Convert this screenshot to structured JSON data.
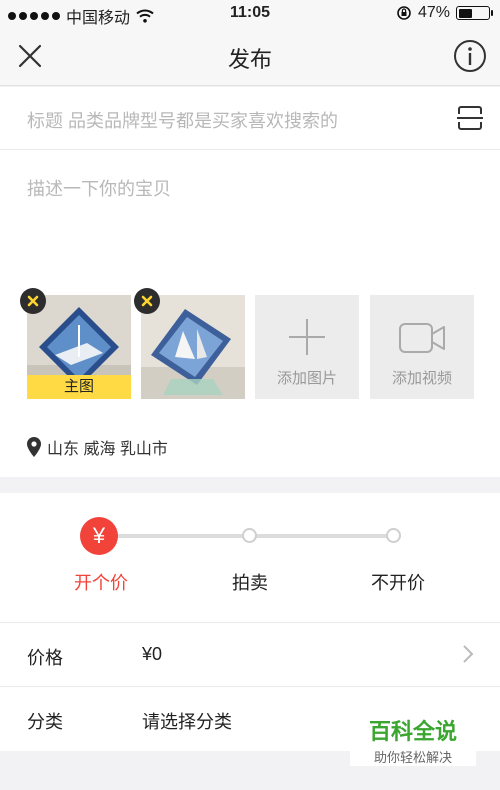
{
  "status_bar": {
    "carrier": "中国移动",
    "time": "11:05",
    "battery": "47%",
    "battery_level": 0.47,
    "icons": [
      "signal-dots-icon",
      "wifi-icon",
      "orientation-lock-icon",
      "battery-icon"
    ]
  },
  "nav": {
    "title": "发布",
    "icons": [
      "close-icon",
      "info-icon"
    ]
  },
  "form": {
    "title_placeholder": "标题 品类品牌型号都是买家喜欢搜索的",
    "description_placeholder": "描述一下你的宝贝",
    "main_image_tag": "主图",
    "add_image_label": "添加图片",
    "add_video_label": "添加视频",
    "location": "山东 威海 乳山市",
    "icons": [
      "scan-icon",
      "remove-icon",
      "plus-icon",
      "video-camera-icon",
      "location-pin-icon"
    ]
  },
  "pricing": {
    "slider_symbol": "¥",
    "options": [
      "开个价",
      "拍卖",
      "不开价"
    ],
    "selected_option": "开个价",
    "accent_color": "#f2433b",
    "price_label": "价格",
    "price_value": "¥0",
    "category_label": "分类",
    "category_value": "请选择分类",
    "icons": [
      "chevron-right-icon"
    ]
  },
  "watermark": {
    "brand": "百科全说",
    "slogan": "助你轻松解决"
  }
}
